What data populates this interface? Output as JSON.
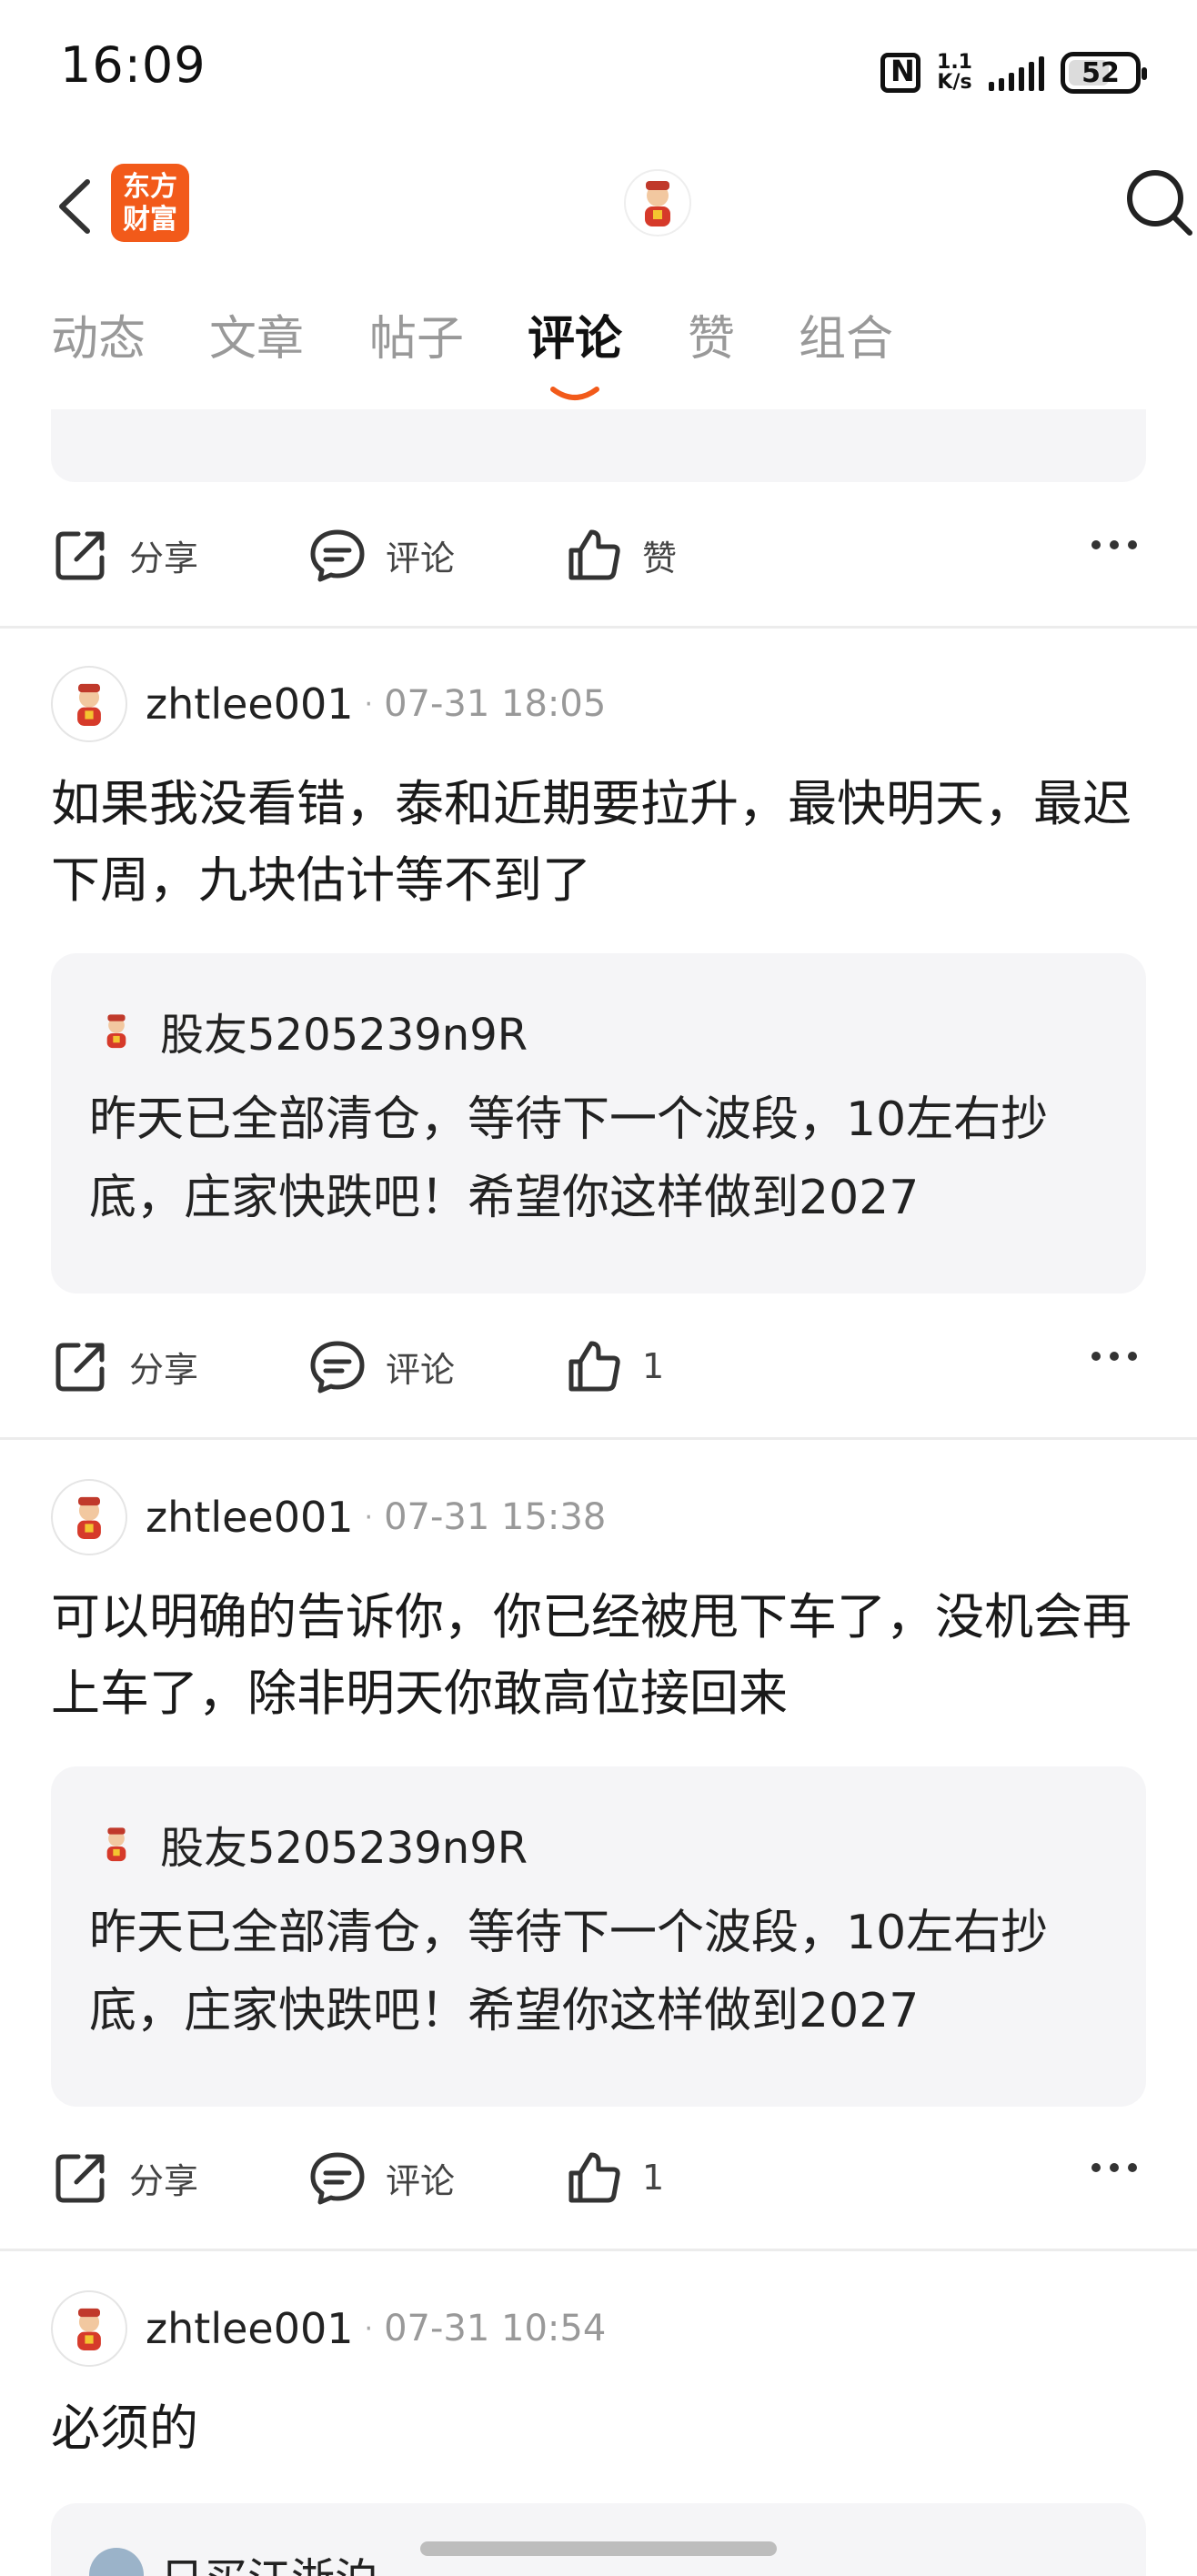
{
  "status_bar": {
    "time": "16:09",
    "net_speed_top": "1.1",
    "net_speed_bottom": "K/s",
    "battery": "52"
  },
  "header": {
    "logo_line1": "东方",
    "logo_line2": "财富"
  },
  "tabs": [
    {
      "label": "动态",
      "active": false
    },
    {
      "label": "文章",
      "active": false
    },
    {
      "label": "帖子",
      "active": false
    },
    {
      "label": "评论",
      "active": true
    },
    {
      "label": "赞",
      "active": false
    },
    {
      "label": "组合",
      "active": false
    }
  ],
  "actions": {
    "share": "分享",
    "comment": "评论",
    "like_default": "赞"
  },
  "posts": [
    {
      "username": "zhtlee001",
      "time": "07-31 18:05",
      "text": "如果我没看错，泰和近期要拉升，最快明天，最迟下周，九块估计等不到了",
      "quote_user": "股友5205239n9R",
      "quote_text": "昨天已全部清仓，等待下一个波段，10左右抄底，庄家快跌吧！希望你这样做到2027",
      "likes": "1"
    },
    {
      "username": "zhtlee001",
      "time": "07-31 15:38",
      "text": "可以明确的告诉你，你已经被甩下车了，没机会再上车了，除非明天你敢高位接回来",
      "quote_user": "股友5205239n9R",
      "quote_text": "昨天已全部清仓，等待下一个波段，10左右抄底，庄家快跌吧！希望你这样做到2027",
      "likes": "1"
    },
    {
      "username": "zhtlee001",
      "time": "07-31 10:54",
      "text": "必须的",
      "quote_user": "日买江浙泊",
      "quote_text": "",
      "likes": ""
    }
  ]
}
